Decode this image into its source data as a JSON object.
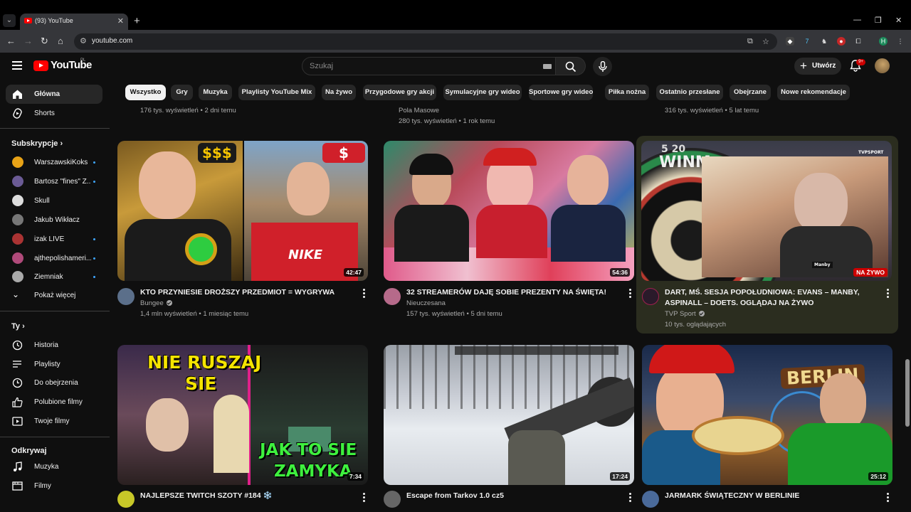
{
  "browser": {
    "tab_title": "(93) YouTube",
    "url": "youtube.com",
    "new_tab": "+",
    "profile_initial": "H"
  },
  "header": {
    "logo": "YouTube",
    "country": "PL",
    "search_placeholder": "Szukaj",
    "create_label": "Utwórz",
    "notifications": "9+"
  },
  "chips": [
    "Wszystko",
    "Gry",
    "Muzyka",
    "Playlisty YouTube Mix",
    "Na żywo",
    "Przygodowe gry akcji",
    "Symulacyjne gry wideo",
    "Sportowe gry wideo",
    "Piłka nożna",
    "Ostatnio przesłane",
    "Obejrzane",
    "Nowe rekomendacje"
  ],
  "sidebar": {
    "main": [
      {
        "label": "Główna",
        "icon": "home-icon"
      },
      {
        "label": "Shorts",
        "icon": "shorts-icon"
      }
    ],
    "subs_heading": "Subskrypcje",
    "subs": [
      {
        "label": "WarszawskiKoks",
        "color": "#e8a317",
        "dot": true
      },
      {
        "label": "Bartosz \"fines\" Z...",
        "color": "#6b5b95",
        "dot": true
      },
      {
        "label": "Skull",
        "color": "#ddd",
        "dot": false
      },
      {
        "label": "Jakub Wikłacz",
        "color": "#777",
        "dot": false
      },
      {
        "label": "izak LIVE",
        "color": "#a33",
        "dot": true
      },
      {
        "label": "ajthepolishameri...",
        "color": "#b04a7a",
        "dot": true
      },
      {
        "label": "Ziemniak",
        "color": "#aaa",
        "dot": true
      }
    ],
    "show_more": "Pokaż więcej",
    "you_heading": "Ty",
    "you": [
      {
        "label": "Historia",
        "icon": "history-icon"
      },
      {
        "label": "Playlisty",
        "icon": "playlists-icon"
      },
      {
        "label": "Do obejrzenia",
        "icon": "watch-later-icon"
      },
      {
        "label": "Polubione filmy",
        "icon": "like-icon"
      },
      {
        "label": "Twoje filmy",
        "icon": "your-videos-icon"
      }
    ],
    "explore_heading": "Odkrywaj",
    "explore": [
      {
        "label": "Muzyka",
        "icon": "music-icon"
      },
      {
        "label": "Filmy",
        "icon": "movies-icon"
      }
    ]
  },
  "partial_row": [
    {
      "channel": "",
      "meta": "176 tys. wyświetleń • 2 dni temu"
    },
    {
      "channel": "Pola Masowe",
      "meta": "280 tys. wyświetleń • 1 rok temu"
    },
    {
      "channel": "",
      "meta": "316 tys. wyświetleń • 5 lat temu"
    }
  ],
  "videos": [
    {
      "title": "KTO PRZYNIESIE DROŻSZY PRZEDMIOT = WYGRYWA",
      "channel": "Bungee",
      "verified": true,
      "meta": "1,4 mln wyświetleń • 1 miesiąc temu",
      "duration": "42:47",
      "overlay": [
        "$$$",
        "$"
      ]
    },
    {
      "title": "32 STREAMERÓW DAJĘ SOBIE PREZENTY NA ŚWIĘTA!",
      "channel": "Nieuczesana",
      "verified": false,
      "meta": "157 tys. wyświetleń • 5 dni temu",
      "duration": "54:36",
      "overlay": []
    },
    {
      "title": "DART, MŚ. SESJA POPOŁUDNIOWA: EVANS – MANBY, ASPINALL – DOETS. OGLĄDAJ NA ŻYWO",
      "channel": "TVP Sport",
      "verified": true,
      "meta": "10 tys. oglądających",
      "duration": "NA ŻYWO",
      "overlay": [
        "WINM",
        "5 20",
        "TVPSPORT"
      ]
    },
    {
      "title": "NAJLEPSZE TWITCH SZOTY #184 ❄️",
      "channel": "",
      "verified": false,
      "meta": "",
      "duration": "7:34",
      "overlay": [
        "NIE RUSZAJ",
        "SIE",
        "JAK TO SIE",
        "ZAMYKA"
      ]
    },
    {
      "title": "Escape from Tarkov 1.0 cz5",
      "channel": "",
      "verified": false,
      "meta": "",
      "duration": "17:24",
      "overlay": []
    },
    {
      "title": "JARMARK ŚWIĄTECZNY W BERLINIE",
      "channel": "",
      "verified": false,
      "meta": "",
      "duration": "25:12",
      "overlay": [
        "BERLIN"
      ]
    }
  ],
  "thumb_extra": {
    "nike": "NIKE",
    "manby": "Manby"
  }
}
